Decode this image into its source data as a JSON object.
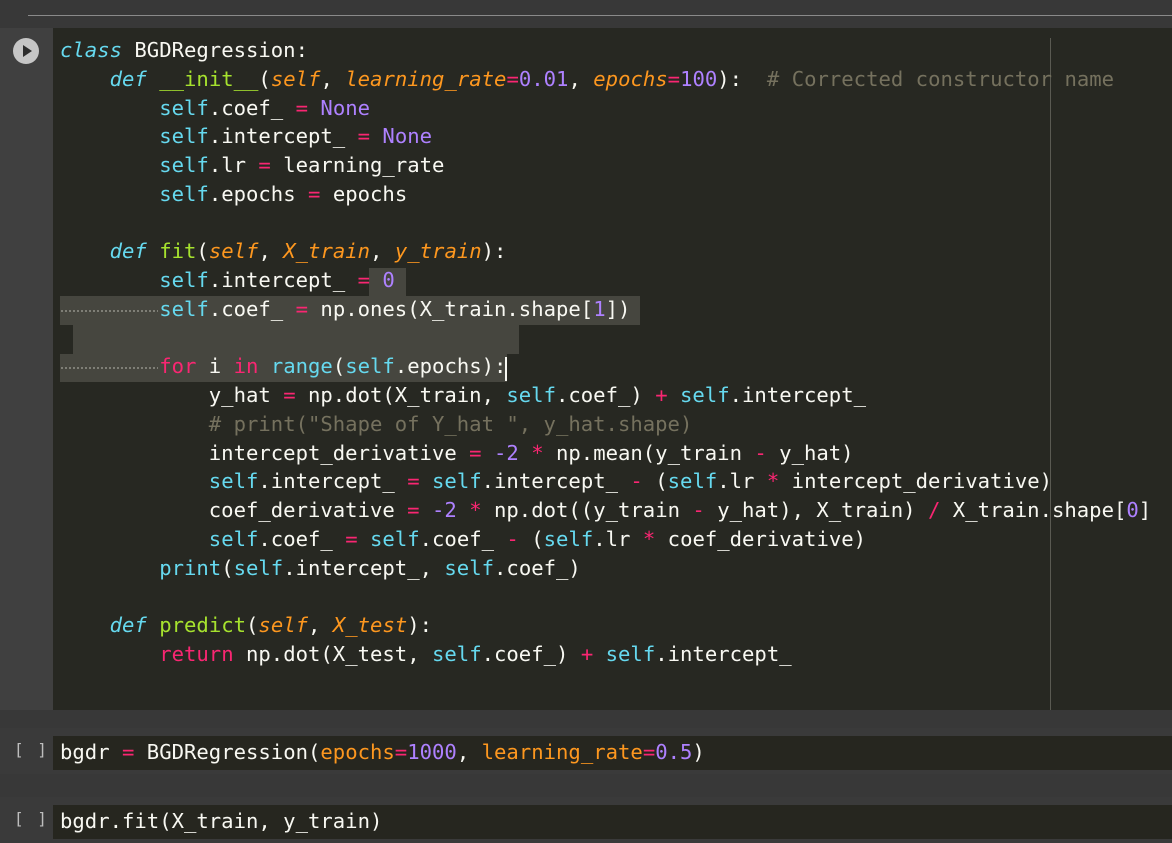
{
  "cells": {
    "main": {
      "lines": [
        [
          {
            "t": "class",
            "c": "kwi"
          },
          {
            "t": " BGDRegression:",
            "c": "cls"
          }
        ],
        [
          {
            "t": "    ",
            "c": ""
          },
          {
            "t": "def",
            "c": "kwi"
          },
          {
            "t": " ",
            "c": ""
          },
          {
            "t": "__init__",
            "c": "fn"
          },
          {
            "t": "(",
            "c": ""
          },
          {
            "t": "self",
            "c": "sfi"
          },
          {
            "t": ", ",
            "c": ""
          },
          {
            "t": "learning_rate",
            "c": "par"
          },
          {
            "t": "=",
            "c": "op"
          },
          {
            "t": "0.01",
            "c": "num"
          },
          {
            "t": ", ",
            "c": ""
          },
          {
            "t": "epochs",
            "c": "par"
          },
          {
            "t": "=",
            "c": "op"
          },
          {
            "t": "100",
            "c": "num"
          },
          {
            "t": "):  ",
            "c": ""
          },
          {
            "t": "# Corrected constructor name",
            "c": "cm"
          }
        ],
        [
          {
            "t": "        ",
            "c": ""
          },
          {
            "t": "self",
            "c": "sf"
          },
          {
            "t": ".coef_ ",
            "c": ""
          },
          {
            "t": "=",
            "c": "op"
          },
          {
            "t": " ",
            "c": ""
          },
          {
            "t": "None",
            "c": "num"
          }
        ],
        [
          {
            "t": "        ",
            "c": ""
          },
          {
            "t": "self",
            "c": "sf"
          },
          {
            "t": ".intercept_ ",
            "c": ""
          },
          {
            "t": "=",
            "c": "op"
          },
          {
            "t": " ",
            "c": ""
          },
          {
            "t": "None",
            "c": "num"
          }
        ],
        [
          {
            "t": "        ",
            "c": ""
          },
          {
            "t": "self",
            "c": "sf"
          },
          {
            "t": ".lr ",
            "c": ""
          },
          {
            "t": "=",
            "c": "op"
          },
          {
            "t": " learning_rate",
            "c": ""
          }
        ],
        [
          {
            "t": "        ",
            "c": ""
          },
          {
            "t": "self",
            "c": "sf"
          },
          {
            "t": ".epochs ",
            "c": ""
          },
          {
            "t": "=",
            "c": "op"
          },
          {
            "t": " epochs",
            "c": ""
          }
        ],
        [],
        [
          {
            "t": "    ",
            "c": ""
          },
          {
            "t": "def",
            "c": "kwi"
          },
          {
            "t": " ",
            "c": ""
          },
          {
            "t": "fit",
            "c": "fn"
          },
          {
            "t": "(",
            "c": ""
          },
          {
            "t": "self",
            "c": "sfi"
          },
          {
            "t": ", ",
            "c": ""
          },
          {
            "t": "X_train",
            "c": "par"
          },
          {
            "t": ", ",
            "c": ""
          },
          {
            "t": "y_train",
            "c": "par"
          },
          {
            "t": "):",
            "c": ""
          }
        ],
        [
          {
            "t": "        ",
            "c": ""
          },
          {
            "t": "self",
            "c": "sf"
          },
          {
            "t": ".intercept_ ",
            "c": ""
          },
          {
            "t": "=",
            "c": "op"
          },
          {
            "t": " ",
            "c": ""
          },
          {
            "t": "0",
            "c": "num"
          }
        ],
        [
          {
            "t": "        ",
            "c": ""
          },
          {
            "t": "self",
            "c": "sf"
          },
          {
            "t": ".coef_ ",
            "c": ""
          },
          {
            "t": "=",
            "c": "op"
          },
          {
            "t": " np.ones(X_train.shape[",
            "c": ""
          },
          {
            "t": "1",
            "c": "num"
          },
          {
            "t": "])",
            "c": ""
          }
        ],
        [],
        [
          {
            "t": "        ",
            "c": ""
          },
          {
            "t": "for",
            "c": "kw"
          },
          {
            "t": " i ",
            "c": ""
          },
          {
            "t": "in",
            "c": "kw"
          },
          {
            "t": " ",
            "c": ""
          },
          {
            "t": "range",
            "c": "bi"
          },
          {
            "t": "(",
            "c": ""
          },
          {
            "t": "self",
            "c": "sf"
          },
          {
            "t": ".epochs):",
            "c": ""
          }
        ],
        [
          {
            "t": "            y_hat ",
            "c": ""
          },
          {
            "t": "=",
            "c": "op"
          },
          {
            "t": " np.dot(X_train, ",
            "c": ""
          },
          {
            "t": "self",
            "c": "sf"
          },
          {
            "t": ".coef_) ",
            "c": ""
          },
          {
            "t": "+",
            "c": "op"
          },
          {
            "t": " ",
            "c": ""
          },
          {
            "t": "self",
            "c": "sf"
          },
          {
            "t": ".intercept_",
            "c": ""
          }
        ],
        [
          {
            "t": "            ",
            "c": ""
          },
          {
            "t": "# print(\"Shape of Y_hat \", y_hat.shape)",
            "c": "cm"
          }
        ],
        [
          {
            "t": "            intercept_derivative ",
            "c": ""
          },
          {
            "t": "=",
            "c": "op"
          },
          {
            "t": " ",
            "c": ""
          },
          {
            "t": "-2",
            "c": "num"
          },
          {
            "t": " ",
            "c": ""
          },
          {
            "t": "*",
            "c": "op"
          },
          {
            "t": " np.mean(y_train ",
            "c": ""
          },
          {
            "t": "-",
            "c": "op"
          },
          {
            "t": " y_hat)",
            "c": ""
          }
        ],
        [
          {
            "t": "            ",
            "c": ""
          },
          {
            "t": "self",
            "c": "sf"
          },
          {
            "t": ".intercept_ ",
            "c": ""
          },
          {
            "t": "=",
            "c": "op"
          },
          {
            "t": " ",
            "c": ""
          },
          {
            "t": "self",
            "c": "sf"
          },
          {
            "t": ".intercept_ ",
            "c": ""
          },
          {
            "t": "-",
            "c": "op"
          },
          {
            "t": " (",
            "c": ""
          },
          {
            "t": "self",
            "c": "sf"
          },
          {
            "t": ".lr ",
            "c": ""
          },
          {
            "t": "*",
            "c": "op"
          },
          {
            "t": " intercept_derivative)",
            "c": ""
          }
        ],
        [
          {
            "t": "            coef_derivative ",
            "c": ""
          },
          {
            "t": "=",
            "c": "op"
          },
          {
            "t": " ",
            "c": ""
          },
          {
            "t": "-2",
            "c": "num"
          },
          {
            "t": " ",
            "c": ""
          },
          {
            "t": "*",
            "c": "op"
          },
          {
            "t": " np.dot((y_train ",
            "c": ""
          },
          {
            "t": "-",
            "c": "op"
          },
          {
            "t": " y_hat), X_train) ",
            "c": ""
          },
          {
            "t": "/",
            "c": "op"
          },
          {
            "t": " X_train.shape[",
            "c": ""
          },
          {
            "t": "0",
            "c": "num"
          },
          {
            "t": "]",
            "c": ""
          }
        ],
        [
          {
            "t": "            ",
            "c": ""
          },
          {
            "t": "self",
            "c": "sf"
          },
          {
            "t": ".coef_ ",
            "c": ""
          },
          {
            "t": "=",
            "c": "op"
          },
          {
            "t": " ",
            "c": ""
          },
          {
            "t": "self",
            "c": "sf"
          },
          {
            "t": ".coef_ ",
            "c": ""
          },
          {
            "t": "-",
            "c": "op"
          },
          {
            "t": " (",
            "c": ""
          },
          {
            "t": "self",
            "c": "sf"
          },
          {
            "t": ".lr ",
            "c": ""
          },
          {
            "t": "*",
            "c": "op"
          },
          {
            "t": " coef_derivative)",
            "c": ""
          }
        ],
        [
          {
            "t": "        ",
            "c": ""
          },
          {
            "t": "print",
            "c": "bi"
          },
          {
            "t": "(",
            "c": ""
          },
          {
            "t": "self",
            "c": "sf"
          },
          {
            "t": ".intercept_, ",
            "c": ""
          },
          {
            "t": "self",
            "c": "sf"
          },
          {
            "t": ".coef_)",
            "c": ""
          }
        ],
        [],
        [
          {
            "t": "    ",
            "c": ""
          },
          {
            "t": "def",
            "c": "kwi"
          },
          {
            "t": " ",
            "c": ""
          },
          {
            "t": "predict",
            "c": "fn"
          },
          {
            "t": "(",
            "c": ""
          },
          {
            "t": "self",
            "c": "sfi"
          },
          {
            "t": ", ",
            "c": ""
          },
          {
            "t": "X_test",
            "c": "par"
          },
          {
            "t": "):",
            "c": ""
          }
        ],
        [
          {
            "t": "        ",
            "c": ""
          },
          {
            "t": "return",
            "c": "kw"
          },
          {
            "t": " np.dot(X_test, ",
            "c": ""
          },
          {
            "t": "self",
            "c": "sf"
          },
          {
            "t": ".coef_) ",
            "c": ""
          },
          {
            "t": "+",
            "c": "op"
          },
          {
            "t": " ",
            "c": ""
          },
          {
            "t": "self",
            "c": "sf"
          },
          {
            "t": ".intercept_",
            "c": ""
          }
        ]
      ]
    },
    "cell2": {
      "bracket": "[ ]",
      "tokens": [
        {
          "t": "bgdr ",
          "c": ""
        },
        {
          "t": "=",
          "c": "op"
        },
        {
          "t": " BGDRegression(",
          "c": ""
        },
        {
          "t": "epochs",
          "c": "kwd"
        },
        {
          "t": "=",
          "c": "op"
        },
        {
          "t": "1000",
          "c": "num"
        },
        {
          "t": ", ",
          "c": ""
        },
        {
          "t": "learning_rate",
          "c": "kwd"
        },
        {
          "t": "=",
          "c": "op"
        },
        {
          "t": "0.5",
          "c": "num"
        },
        {
          "t": ")",
          "c": ""
        }
      ]
    },
    "cell3": {
      "bracket": "[ ]",
      "tokens": [
        {
          "t": "bgdr.fit(X_train, y_train)",
          "c": ""
        }
      ]
    }
  },
  "colors": {
    "editor_bg": "#272822",
    "keyword": "#f92672",
    "function": "#a6e22e",
    "builtin": "#66d9ef",
    "param": "#fd971f",
    "number": "#ae81ff",
    "comment": "#75715e"
  },
  "icons": {
    "run": "play-icon"
  }
}
